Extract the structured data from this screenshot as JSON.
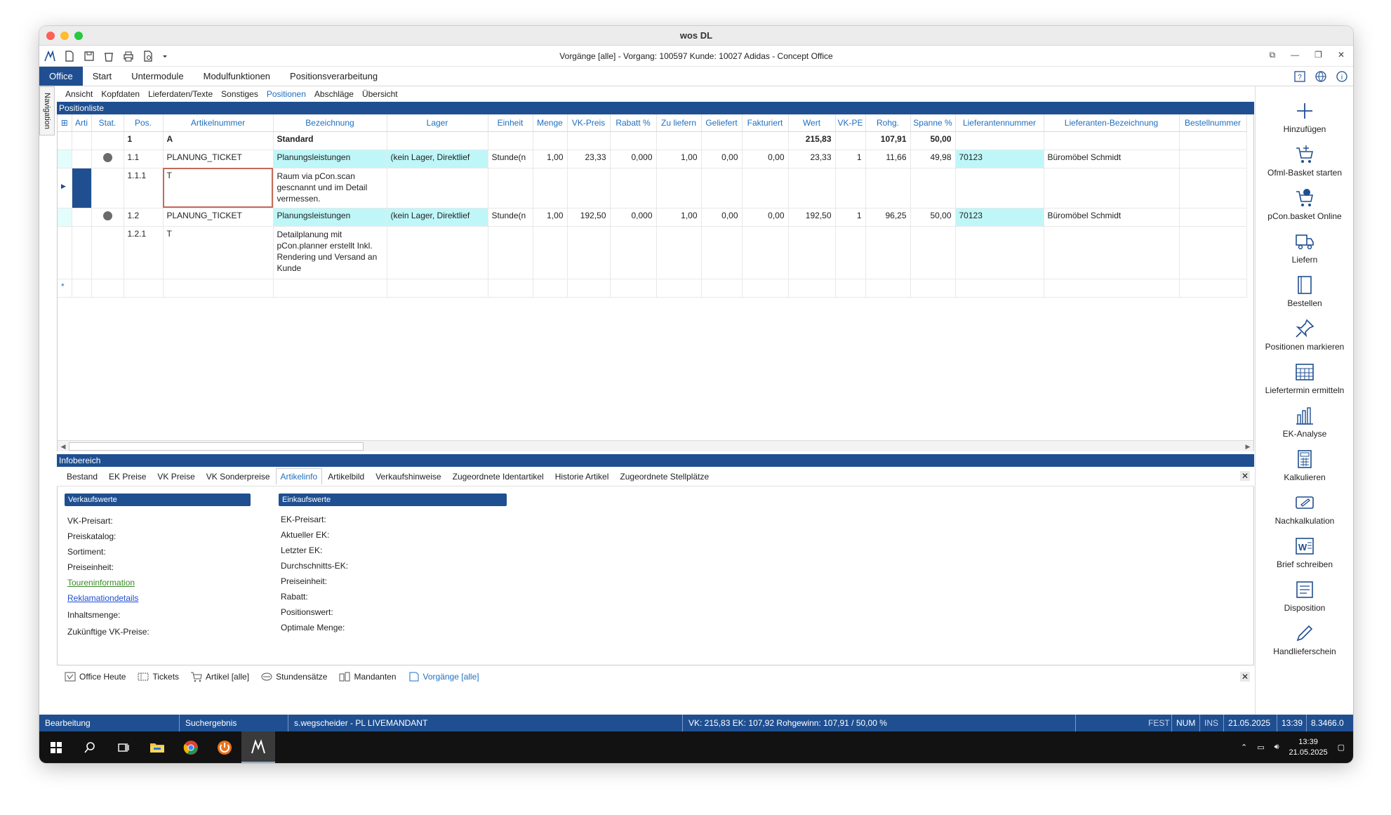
{
  "window": {
    "title": "wos DL",
    "app_title": "Vorgänge [alle] - Vorgang: 100597 Kunde: 10027 Adidas - Concept Office"
  },
  "menu": {
    "items": [
      "Office",
      "Start",
      "Untermodule",
      "Modulfunktionen",
      "Positionsverarbeitung"
    ]
  },
  "nav_label": "Navigation",
  "subtabs": [
    "Ansicht",
    "Kopfdaten",
    "Lieferdaten/Texte",
    "Sonstiges",
    "Positionen",
    "Abschläge",
    "Übersicht"
  ],
  "positionliste": {
    "title": "Positionliste",
    "columns": [
      "Arti",
      "Stat.",
      "Pos.",
      "Artikelnummer",
      "Bezeichnung",
      "Lager",
      "Einheit",
      "Menge",
      "VK-Preis",
      "Rabatt %",
      "Zu liefern",
      "Geliefert",
      "Fakturiert",
      "Wert",
      "VK-PE",
      "Rohg.",
      "Spanne %",
      "Lieferantennummer",
      "Lieferanten-Bezeichnung",
      "Bestellnummer"
    ],
    "rows": [
      {
        "pos": "1",
        "artnr": "A",
        "bez": "Standard",
        "wert": "215,83",
        "rohg": "107,91",
        "spanne": "50,00"
      },
      {
        "pos": "1.1",
        "artnr": "PLANUNG_TICKET",
        "bez": "Planungsleistungen",
        "lager": "(kein Lager, Direktlief",
        "einheit": "Stunde(n",
        "menge": "1,00",
        "vkpreis": "23,33",
        "rabatt": "0,000",
        "zuliefern": "1,00",
        "geliefert": "0,00",
        "fakturiert": "0,00",
        "wert": "23,33",
        "vkpe": "1",
        "rohg": "11,66",
        "spanne": "49,98",
        "liefnr": "70123",
        "liefbez": "Büromöbel Schmidt"
      },
      {
        "pos": "1.1.1",
        "artnr": "T",
        "bez": "Raum via pCon.scan gescnannt und im Detail vermessen."
      },
      {
        "pos": "1.2",
        "artnr": "PLANUNG_TICKET",
        "bez": "Planungsleistungen",
        "lager": "(kein Lager, Direktlief",
        "einheit": "Stunde(n",
        "menge": "1,00",
        "vkpreis": "192,50",
        "rabatt": "0,000",
        "zuliefern": "1,00",
        "geliefert": "0,00",
        "fakturiert": "0,00",
        "wert": "192,50",
        "vkpe": "1",
        "rohg": "96,25",
        "spanne": "50,00",
        "liefnr": "70123",
        "liefbez": "Büromöbel Schmidt"
      },
      {
        "pos": "1.2.1",
        "artnr": "T",
        "bez": "Detailplanung mit pCon.planner erstellt Inkl. Rendering und Versand an Kunde"
      }
    ],
    "new_row_marker": "*"
  },
  "infobereich": {
    "title": "Infobereich",
    "tabs": [
      "Bestand",
      "EK Preise",
      "VK Preise",
      "VK Sonderpreise",
      "Artikelinfo",
      "Artikelbild",
      "Verkaufshinweise",
      "Zugeordnete Identartikel",
      "Historie Artikel",
      "Zugeordnete Stellplätze"
    ],
    "verkauf_header": "Verkaufswerte",
    "einkauf_header": "Einkaufswerte",
    "verkauf_labels": [
      "VK-Preisart:",
      "Preiskatalog:",
      "Sortiment:",
      "Preiseinheit:",
      "Toureninformation",
      "Reklamationdetails",
      "Inhaltsmenge:",
      "Zukünftige VK-Preise:"
    ],
    "einkauf_labels": [
      "EK-Preisart:",
      "Aktueller EK:",
      "Letzter EK:",
      "Durchschnitts-EK:",
      "Preiseinheit:",
      "Rabatt:",
      "Positionswert:",
      "Optimale Menge:"
    ]
  },
  "bottom_tabs": [
    "Office Heute",
    "Tickets",
    "Artikel [alle]",
    "Stundensätze",
    "Mandanten",
    "Vorgänge [alle]"
  ],
  "sidebar": [
    "Hinzufügen",
    "Ofml-Basket starten",
    "pCon.basket Online",
    "Liefern",
    "Bestellen",
    "Positionen markieren",
    "Liefertermin ermitteln",
    "EK-Analyse",
    "Kalkulieren",
    "Nachkalkulation",
    "Brief schreiben",
    "Disposition",
    "Handlieferschein"
  ],
  "statusbar": {
    "mode": "Bearbeitung",
    "search": "Suchergebnis",
    "user": "s.wegscheider - PL LIVEMANDANT",
    "summary": "VK: 215,83 EK: 107,92 Rohgewinn: 107,91 / 50,00 %",
    "fest": "FEST",
    "num": "NUM",
    "ins": "INS",
    "date": "21.05.2025",
    "time": "13:39",
    "version": "8.3466.0"
  },
  "taskbar": {
    "time": "13:39",
    "date": "21.05.2025"
  },
  "colors": {
    "accent": "#1f4f91",
    "highlight": "#bff7f9",
    "link_blue": "#1f6fc0"
  }
}
